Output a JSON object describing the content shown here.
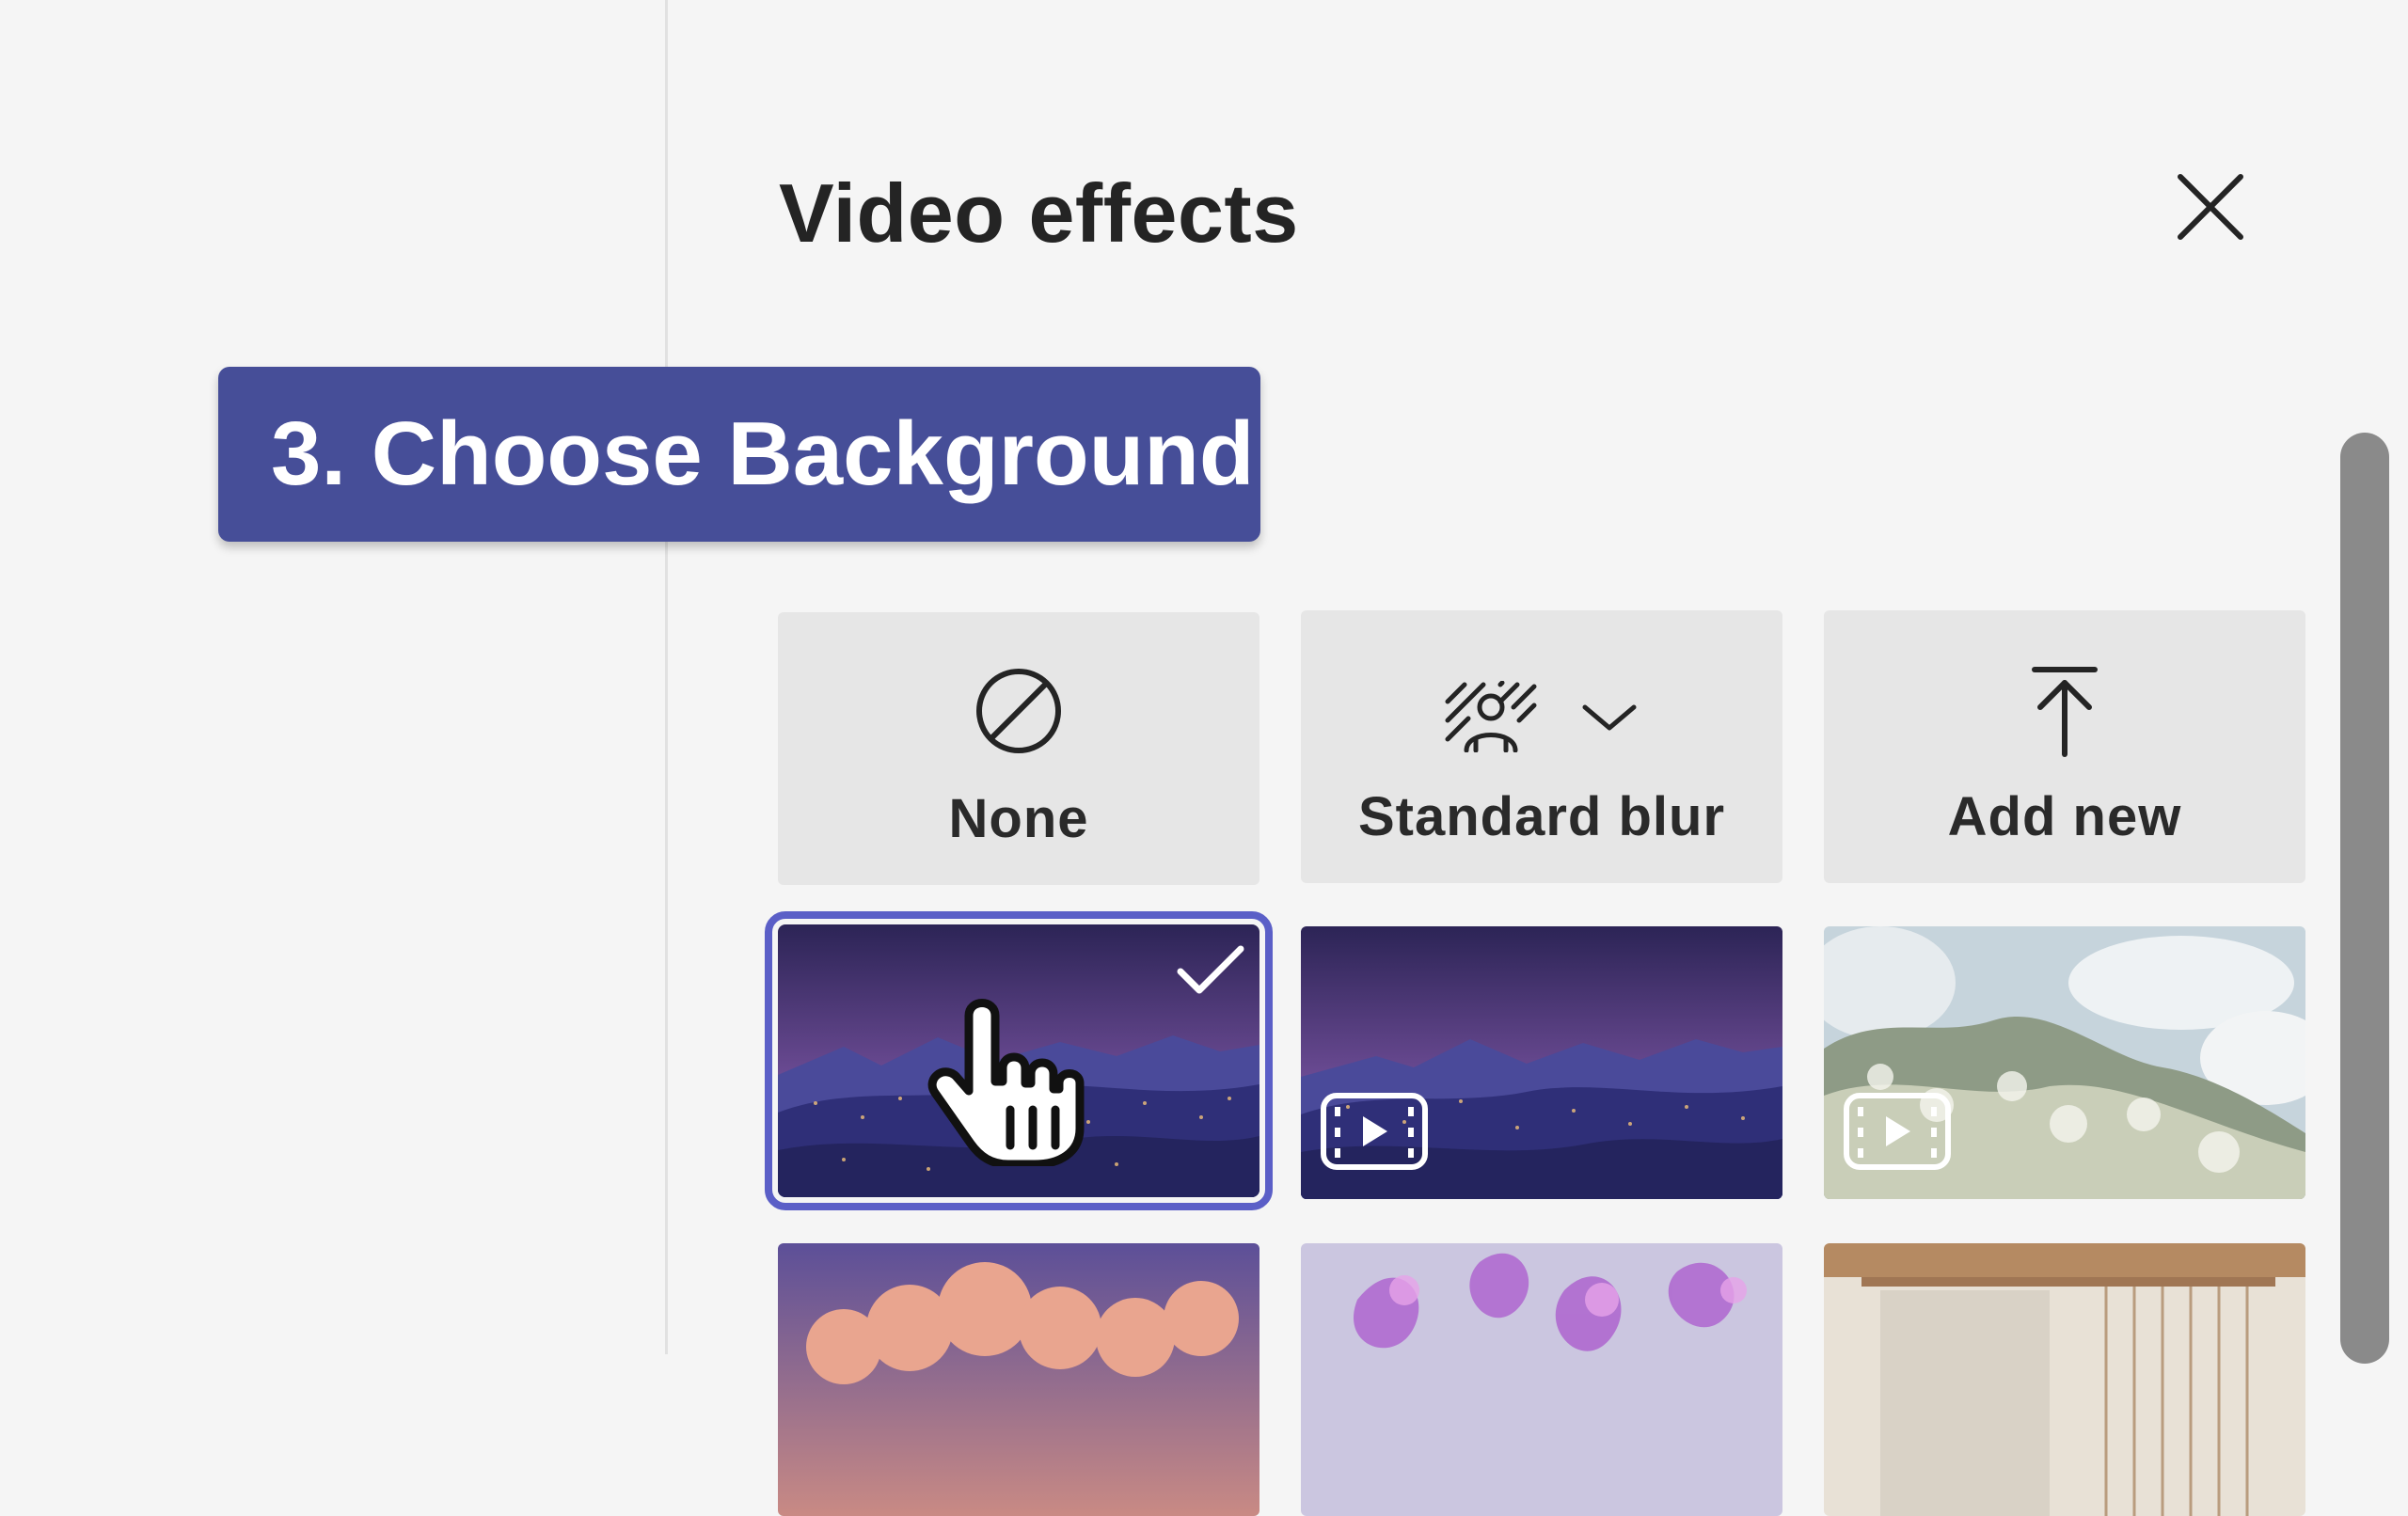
{
  "panel": {
    "title": "Video effects",
    "close_icon": "close-icon"
  },
  "callout": {
    "text": "3. Choose Background",
    "color": "#464e98"
  },
  "effects": {
    "none_label": "None",
    "blur_label": "Standard blur",
    "add_label": "Add new"
  },
  "backgrounds": [
    {
      "name": "purple-night-landscape",
      "selected": true,
      "video": false
    },
    {
      "name": "purple-night-landscape-video",
      "selected": false,
      "video": true
    },
    {
      "name": "white-blossom-clouds-video",
      "selected": false,
      "video": true
    },
    {
      "name": "pink-clouds",
      "selected": false,
      "video": false
    },
    {
      "name": "purple-flowers",
      "selected": false,
      "video": false
    },
    {
      "name": "wooden-room",
      "selected": false,
      "video": false
    }
  ],
  "accent_color": "#5b5fc7"
}
